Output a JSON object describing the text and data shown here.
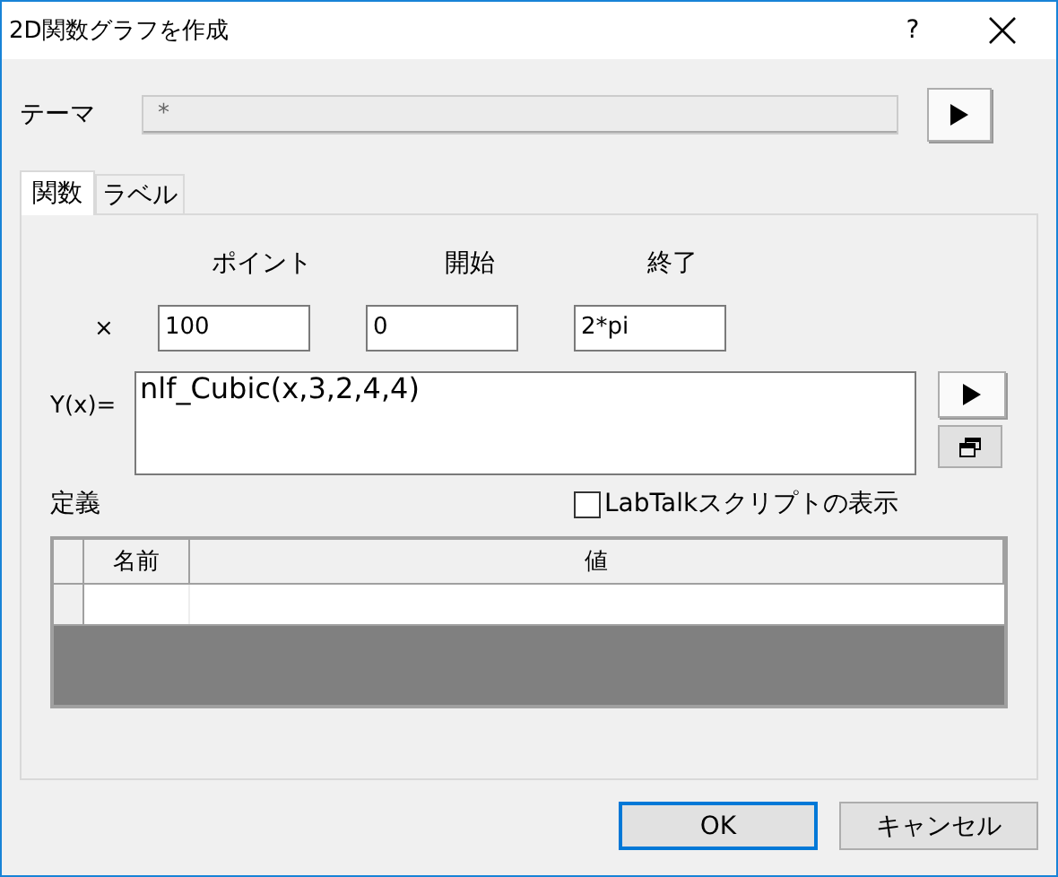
{
  "window": {
    "title": "2D関数グラフを作成",
    "help": "?"
  },
  "theme": {
    "label": "テーマ",
    "value": "*"
  },
  "tabs": [
    {
      "label": "関数",
      "selected": true
    },
    {
      "label": "ラベル",
      "selected": false
    }
  ],
  "x_range": {
    "row_label": "×",
    "columns": [
      {
        "heading": "ポイント",
        "value": "100"
      },
      {
        "heading": "開始",
        "value": "0"
      },
      {
        "heading": "終了",
        "value": "2*pi"
      }
    ]
  },
  "function": {
    "label": "Y(x)=",
    "value": "nlf_Cubic(x,3,2,4,4)"
  },
  "definitions": {
    "label": "定義",
    "show_script": {
      "label": "LabTalkスクリプトの表示",
      "checked": false
    },
    "columns": [
      "名前",
      "値"
    ]
  },
  "buttons": [
    {
      "label": "OK",
      "default": true
    },
    {
      "label": "キャンセル",
      "default": false
    }
  ]
}
